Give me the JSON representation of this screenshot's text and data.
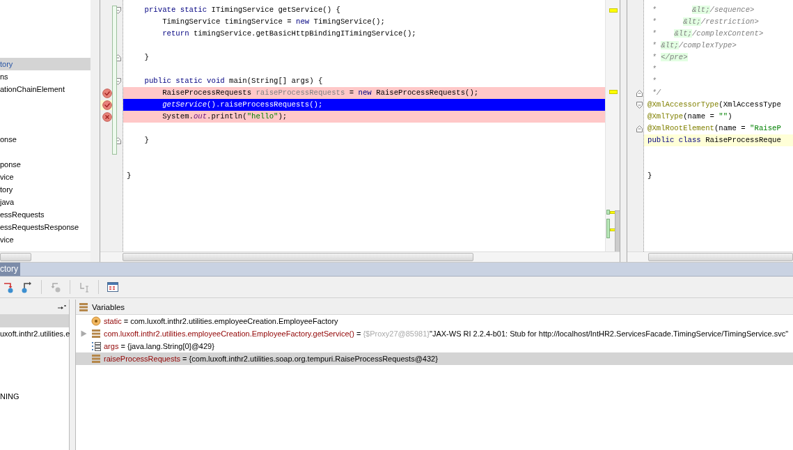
{
  "tree": {
    "items": [
      {
        "label": "tory",
        "selected": true
      },
      {
        "label": "ns",
        "selected": false
      },
      {
        "label": "ationChainElement",
        "selected": false
      },
      {
        "selected": false
      },
      {
        "selected": false
      },
      {
        "selected": false
      },
      {
        "label": "onse",
        "selected": false
      },
      {
        "selected": false
      },
      {
        "label": "ponse",
        "selected": false
      },
      {
        "label": "vice",
        "selected": false
      },
      {
        "label": "tory",
        "selected": false
      },
      {
        "label": "java",
        "selected": false
      },
      {
        "label": "essRequests",
        "selected": false
      },
      {
        "label": "essRequestsResponse",
        "selected": false
      },
      {
        "label": "vice",
        "selected": false
      }
    ]
  },
  "editors": [
    {
      "lines": [
        {
          "kind": "code",
          "fold_start": true,
          "tokens": [
            {
              "kind": "keyword",
              "text": "    private static"
            },
            {
              "kind": "plain",
              "text": " ITimingService getService() {"
            }
          ]
        },
        {
          "kind": "code",
          "tokens": [
            {
              "kind": "plain",
              "text": "        TimingService timingService = "
            },
            {
              "kind": "keyword",
              "text": "new"
            },
            {
              "kind": "plain",
              "text": " TimingService();"
            }
          ]
        },
        {
          "kind": "code",
          "tokens": [
            {
              "kind": "keyword",
              "text": "        return"
            },
            {
              "kind": "plain",
              "text": " timingService.getBasicHttpBindingITimingService();"
            }
          ]
        },
        {
          "kind": "blank"
        },
        {
          "kind": "code",
          "fold_end": true,
          "tokens": [
            {
              "kind": "plain",
              "text": "    }"
            }
          ]
        },
        {
          "kind": "blank"
        },
        {
          "kind": "code",
          "fold_start": true,
          "tokens": [
            {
              "kind": "keyword",
              "text": "    public static void"
            },
            {
              "kind": "plain",
              "text": " main(String[] args) {"
            }
          ]
        },
        {
          "kind": "code",
          "breakpoint": true,
          "verified": true,
          "execution": false,
          "tokens": [
            {
              "kind": "plain",
              "text": "        RaiseProcessRequests "
            },
            {
              "kind": "unused",
              "text": "raiseProcessRequests"
            },
            {
              "kind": "plain",
              "text": " = "
            },
            {
              "kind": "keyword",
              "text": "new"
            },
            {
              "kind": "plain",
              "text": " RaiseProcessRequests();"
            }
          ]
        },
        {
          "kind": "code",
          "breakpoint": true,
          "verified": true,
          "execution": true,
          "tokens": [
            {
              "kind": "static-call",
              "text": "        getService"
            },
            {
              "kind": "plain",
              "text": "().raiseProcessRequests();"
            }
          ]
        },
        {
          "kind": "code",
          "breakpoint": true,
          "verified": false,
          "execution": false,
          "tokens": [
            {
              "kind": "plain",
              "text": "        System."
            },
            {
              "kind": "field",
              "text": "out"
            },
            {
              "kind": "plain",
              "text": ".println("
            },
            {
              "kind": "string",
              "text": "\"hello\""
            },
            {
              "kind": "plain",
              "text": ");"
            }
          ]
        },
        {
          "kind": "blank"
        },
        {
          "kind": "code",
          "fold_end": true,
          "tokens": [
            {
              "kind": "plain",
              "text": "    }"
            }
          ]
        },
        {
          "kind": "blank"
        },
        {
          "kind": "blank"
        },
        {
          "kind": "code",
          "tokens": [
            {
              "kind": "plain",
              "text": "}"
            }
          ]
        }
      ]
    },
    {
      "lines": [
        {
          "kind": "code",
          "tokens": [
            {
              "kind": "comment",
              "text": " *        "
            },
            {
              "kind": "doc-markup",
              "text": "&lt;"
            },
            {
              "kind": "comment",
              "text": "/sequence>"
            }
          ]
        },
        {
          "kind": "code",
          "tokens": [
            {
              "kind": "comment",
              "text": " *      "
            },
            {
              "kind": "doc-markup",
              "text": "&lt;"
            },
            {
              "kind": "comment",
              "text": "/restriction>"
            }
          ]
        },
        {
          "kind": "code",
          "tokens": [
            {
              "kind": "comment",
              "text": " *    "
            },
            {
              "kind": "doc-markup",
              "text": "&lt;"
            },
            {
              "kind": "comment",
              "text": "/complexContent>"
            }
          ]
        },
        {
          "kind": "code",
          "tokens": [
            {
              "kind": "comment",
              "text": " * "
            },
            {
              "kind": "doc-markup",
              "text": "&lt;"
            },
            {
              "kind": "comment",
              "text": "/complexType>"
            }
          ]
        },
        {
          "kind": "code",
          "tokens": [
            {
              "kind": "comment",
              "text": " * "
            },
            {
              "kind": "doc-markup",
              "text": "</pre>"
            }
          ]
        },
        {
          "kind": "code",
          "tokens": [
            {
              "kind": "comment",
              "text": " *"
            }
          ]
        },
        {
          "kind": "code",
          "tokens": [
            {
              "kind": "comment",
              "text": " *"
            }
          ]
        },
        {
          "kind": "code",
          "fold_end": true,
          "tokens": [
            {
              "kind": "comment",
              "text": " */"
            }
          ]
        },
        {
          "kind": "code",
          "fold_start": true,
          "tokens": [
            {
              "kind": "annotation",
              "text": "@XmlAccessorType"
            },
            {
              "kind": "plain",
              "text": "(XmlAccessType"
            }
          ]
        },
        {
          "kind": "code",
          "tokens": [
            {
              "kind": "annotation",
              "text": "@XmlType"
            },
            {
              "kind": "plain",
              "text": "(name = "
            },
            {
              "kind": "string",
              "text": "\"\""
            },
            {
              "kind": "plain",
              "text": ")"
            }
          ]
        },
        {
          "kind": "code",
          "fold_end": true,
          "tokens": [
            {
              "kind": "annotation",
              "text": "@XmlRootElement"
            },
            {
              "kind": "plain",
              "text": "(name = "
            },
            {
              "kind": "string",
              "text": "\"RaiseP"
            }
          ]
        },
        {
          "kind": "code",
          "caret": true,
          "tokens": [
            {
              "kind": "keyword",
              "text": "public class"
            },
            {
              "kind": "plain",
              "text": " RaiseProcessReque"
            }
          ]
        },
        {
          "kind": "blank"
        },
        {
          "kind": "blank"
        },
        {
          "kind": "code",
          "tokens": [
            {
              "kind": "plain",
              "text": "}"
            }
          ]
        }
      ]
    }
  ],
  "debug_tabs": [
    {
      "label": "ctory",
      "selected": true
    }
  ],
  "toolbar": {
    "buttons": [
      {
        "kind": "force-step-into",
        "disabled": false
      },
      {
        "kind": "step-out",
        "disabled": false
      },
      {
        "kind": "drop-frame",
        "disabled": true
      },
      {
        "kind": "run-to-cursor",
        "disabled": true
      },
      {
        "kind": "evaluate",
        "disabled": false
      }
    ]
  },
  "frames": {
    "items": [
      {
        "selected": true
      },
      {
        "label": "uxoft.inthr2.utilities.e",
        "selected": false
      },
      {
        "selected": false
      },
      {
        "selected": false
      },
      {
        "selected": false
      },
      {
        "selected": false
      },
      {
        "label": "NING",
        "selected": false
      }
    ]
  },
  "variables": {
    "title": "Variables",
    "rows": [
      {
        "kind": "static",
        "expandable": false,
        "selected": false,
        "name": "static",
        "operator": "=",
        "value": "com.luxoft.inthr2.utilities.employeeCreation.EmployeeFactory"
      },
      {
        "kind": "object",
        "expandable": true,
        "selected": false,
        "name": "com.luxoft.inthr2.utilities.employeeCreation.EmployeeFactory.getService()",
        "operator": "=",
        "reference": "{$Proxy27@85981}",
        "value": "\"JAX-WS RI 2.2.4-b01: Stub for http://localhost/IntHR2.ServicesFacade.TimingService/TimingService.svc\""
      },
      {
        "kind": "array",
        "expandable": false,
        "selected": false,
        "name": "args",
        "operator": "=",
        "value": "{java.lang.String[0]@429}"
      },
      {
        "kind": "object",
        "expandable": false,
        "selected": true,
        "name": "raiseProcessRequests",
        "operator": "=",
        "value": "{com.luxoft.inthr2.utilities.soap.org.tempuri.RaiseProcessRequests@432}"
      }
    ]
  }
}
